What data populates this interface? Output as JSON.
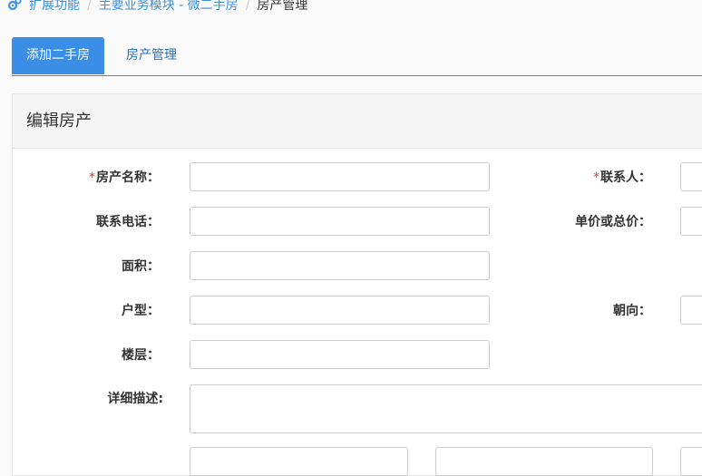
{
  "breadcrumb": {
    "items": [
      "扩展功能",
      "主要业务模块 - 微二手房",
      "房产管理"
    ]
  },
  "tabs": [
    {
      "label": "添加二手房",
      "active": true
    },
    {
      "label": "房产管理",
      "active": false
    }
  ],
  "panel": {
    "title": "编辑房产"
  },
  "form": {
    "required_mark": "*",
    "house_name": {
      "label": "房产名称：",
      "value": ""
    },
    "contact_person": {
      "label": "联系人：",
      "value": ""
    },
    "phone": {
      "label": "联系电话：",
      "value": ""
    },
    "price": {
      "label": "单价或总价：",
      "value": ""
    },
    "area": {
      "label": "面积：",
      "value": ""
    },
    "layout": {
      "label": "户型：",
      "value": ""
    },
    "orientation": {
      "label": "朝向：",
      "value": ""
    },
    "floor": {
      "label": "楼层：",
      "value": ""
    },
    "description": {
      "label": "详细描述:",
      "value": ""
    }
  },
  "colors": {
    "accent": "#3a8ee6",
    "required": "#e33333"
  }
}
